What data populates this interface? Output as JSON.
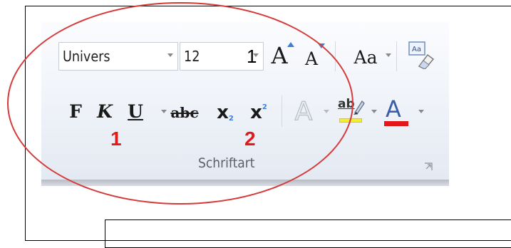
{
  "ribbon_group": {
    "font_name": "Univers",
    "font_size": "12",
    "grow_font": "A",
    "shrink_font": "A",
    "change_case": "Aa",
    "bold": "F",
    "italic": "K",
    "underline": "U",
    "strikethrough": "abc",
    "subscript": "x",
    "subscript_mark": "2",
    "superscript": "x",
    "superscript_mark": "2",
    "text_effects": "A",
    "highlight": "ab",
    "font_color": "A",
    "group_label": "Schriftart"
  },
  "annotations": {
    "overlay_number": "1",
    "label_one": "1",
    "label_two": "2"
  },
  "colors": {
    "annotation": "#e01b1b",
    "font_color_bar": "#e2161b",
    "highlight_bar": "#f3ef2c"
  },
  "icons": [
    "clear-formatting-icon",
    "dialog-launcher-icon",
    "dropdown-arrow-icon"
  ]
}
